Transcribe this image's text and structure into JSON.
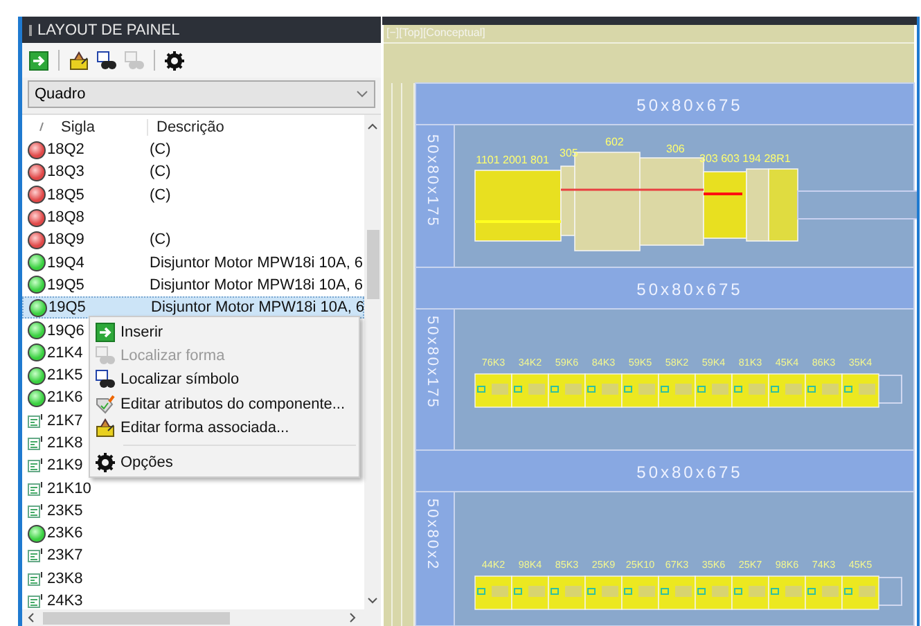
{
  "panel": {
    "title": "LAYOUT DE PAINEL",
    "toolbar": [
      {
        "kind": "insert",
        "disabled": false
      },
      {
        "kind": "separator"
      },
      {
        "kind": "edit-shape",
        "disabled": false
      },
      {
        "kind": "find-symbol",
        "disabled": false
      },
      {
        "kind": "find-shape",
        "disabled": true
      },
      {
        "kind": "separator"
      },
      {
        "kind": "options",
        "disabled": false
      }
    ],
    "dropdown": {
      "value": "Quadro"
    },
    "columns": [
      "Sigla",
      "Descrição"
    ],
    "rows": [
      {
        "sigla": "18Q2",
        "descricao": "(C)",
        "kind": "off",
        "selected": false
      },
      {
        "sigla": "18Q3",
        "descricao": "(C)",
        "kind": "off",
        "selected": false
      },
      {
        "sigla": "18Q5",
        "descricao": "(C)",
        "kind": "off",
        "selected": false
      },
      {
        "sigla": "18Q8",
        "kind": "off",
        "selected": false
      },
      {
        "sigla": "18Q9",
        "descricao": "(C)",
        "kind": "off",
        "selected": false
      },
      {
        "sigla": "19Q4",
        "descricao": "Disjuntor Motor MPW18i 10A, 6",
        "kind": "on",
        "selected": false
      },
      {
        "sigla": "19Q5",
        "descricao": "Disjuntor Motor MPW18i 10A, 6",
        "kind": "on",
        "selected": false
      },
      {
        "sigla": "19Q5",
        "descricao": "Disjuntor Motor MPW18i 10A, 6",
        "kind": "on",
        "selected": true
      },
      {
        "sigla": "19Q6",
        "kind": "on",
        "selected": false
      },
      {
        "sigla": "21K4",
        "kind": "on",
        "selected": false
      },
      {
        "sigla": "21K5",
        "kind": "on",
        "selected": false
      },
      {
        "sigla": "21K6",
        "kind": "on",
        "selected": false
      },
      {
        "sigla": "21K7",
        "kind": "symbol",
        "selected": false
      },
      {
        "sigla": "21K8",
        "kind": "symbol",
        "selected": false
      },
      {
        "sigla": "21K9",
        "kind": "symbol",
        "selected": false
      },
      {
        "sigla": "21K10",
        "kind": "symbol",
        "selected": false
      },
      {
        "sigla": "23K5",
        "kind": "symbol",
        "selected": false
      },
      {
        "sigla": "23K6",
        "kind": "on",
        "selected": false
      },
      {
        "sigla": "23K7",
        "kind": "symbol",
        "selected": false
      },
      {
        "sigla": "23K8",
        "kind": "symbol",
        "selected": false
      },
      {
        "sigla": "24K3",
        "kind": "symbol",
        "selected": false
      }
    ]
  },
  "context_menu": [
    {
      "label": "Inserir",
      "kind": "insert",
      "disabled": false
    },
    {
      "label": "Localizar forma",
      "kind": "find-shape",
      "disabled": true
    },
    {
      "label": "Localizar símbolo",
      "kind": "find-symbol",
      "disabled": false
    },
    {
      "label": "Editar atributos do componente...",
      "kind": "edit-attributes",
      "disabled": false
    },
    {
      "label": "Editar forma associada...",
      "kind": "edit-shape",
      "disabled": false
    },
    {
      "kind": "separator"
    },
    {
      "label": "Opções",
      "kind": "options",
      "disabled": false
    }
  ],
  "cad": {
    "view_label": "[−][Top][Conceptual]",
    "horizontal_ducts": [
      "50x80x675",
      "50x80x675",
      "50x80x675"
    ],
    "vertical_ducts": [
      "50x80x175",
      "50x80x175",
      "50x80x2"
    ],
    "rail_1_labels": [
      "1101 2001 801",
      "305",
      "602",
      "306",
      "303 603 194 28R1"
    ],
    "rails": [
      {
        "labels": [
          "76K3",
          "34K2",
          "59K6",
          "84K3",
          "59K5",
          "58K2",
          "59K4",
          "81K3",
          "45K4",
          "86K3",
          "35K4"
        ]
      },
      {
        "labels": [
          "44K2",
          "98K4",
          "85K3",
          "25K9",
          "25K10",
          "67K3",
          "35K6",
          "25K7",
          "98K6",
          "74K3",
          "45K5"
        ]
      }
    ]
  }
}
